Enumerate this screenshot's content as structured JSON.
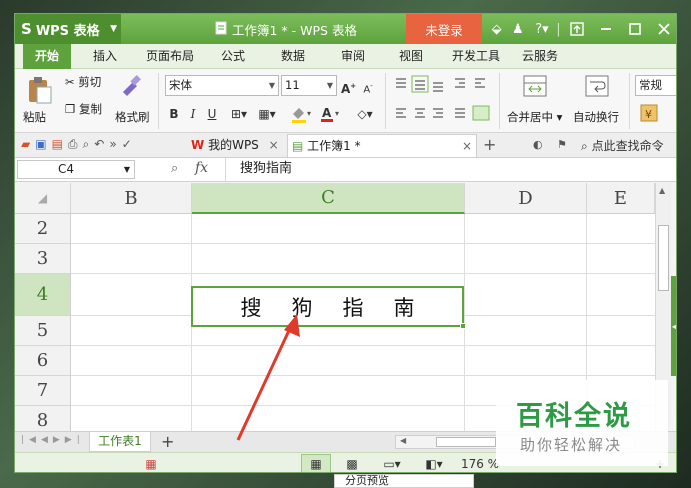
{
  "titlebar": {
    "app_name": "WPS 表格",
    "doc_title": "工作簿1 * - WPS 表格",
    "login_label": "未登录",
    "help_label": "?"
  },
  "menu": {
    "tabs": [
      "开始",
      "插入",
      "页面布局",
      "公式",
      "数据",
      "审阅",
      "视图",
      "开发工具",
      "云服务"
    ]
  },
  "ribbon": {
    "paste_label": "粘贴",
    "cut_label": "剪切",
    "copy_label": "复制",
    "format_painter_label": "格式刷",
    "font_name": "宋体",
    "font_size": "11",
    "bold": "B",
    "italic": "I",
    "underline": "U",
    "merge_label": "合并居中",
    "wrap_label": "自动换行",
    "number_format": "常规"
  },
  "doctabs": {
    "wps_tab": "我的WPS",
    "book_tab": "工作簿1 *",
    "search_label": "点此查找命令"
  },
  "formula_bar": {
    "cell_ref": "C4",
    "fx_label": "fx",
    "formula_value": "搜狗指南"
  },
  "grid": {
    "columns": [
      "B",
      "C",
      "D",
      "E"
    ],
    "rows": [
      "2",
      "3",
      "4",
      "5",
      "6",
      "7",
      "8"
    ],
    "selected_cell_text": "搜狗指南"
  },
  "sheetbar": {
    "sheet_name": "工作表1",
    "add_label": "+"
  },
  "statusbar": {
    "zoom": "176 %",
    "tooltip": "分页预览"
  },
  "watermark": {
    "title": "百科全说",
    "subtitle": "助你轻松解决"
  },
  "colors": {
    "accent": "#5ea23e",
    "login": "#e8633f",
    "arrow": "#e03a2a",
    "watermark_green": "#2f9a45"
  }
}
